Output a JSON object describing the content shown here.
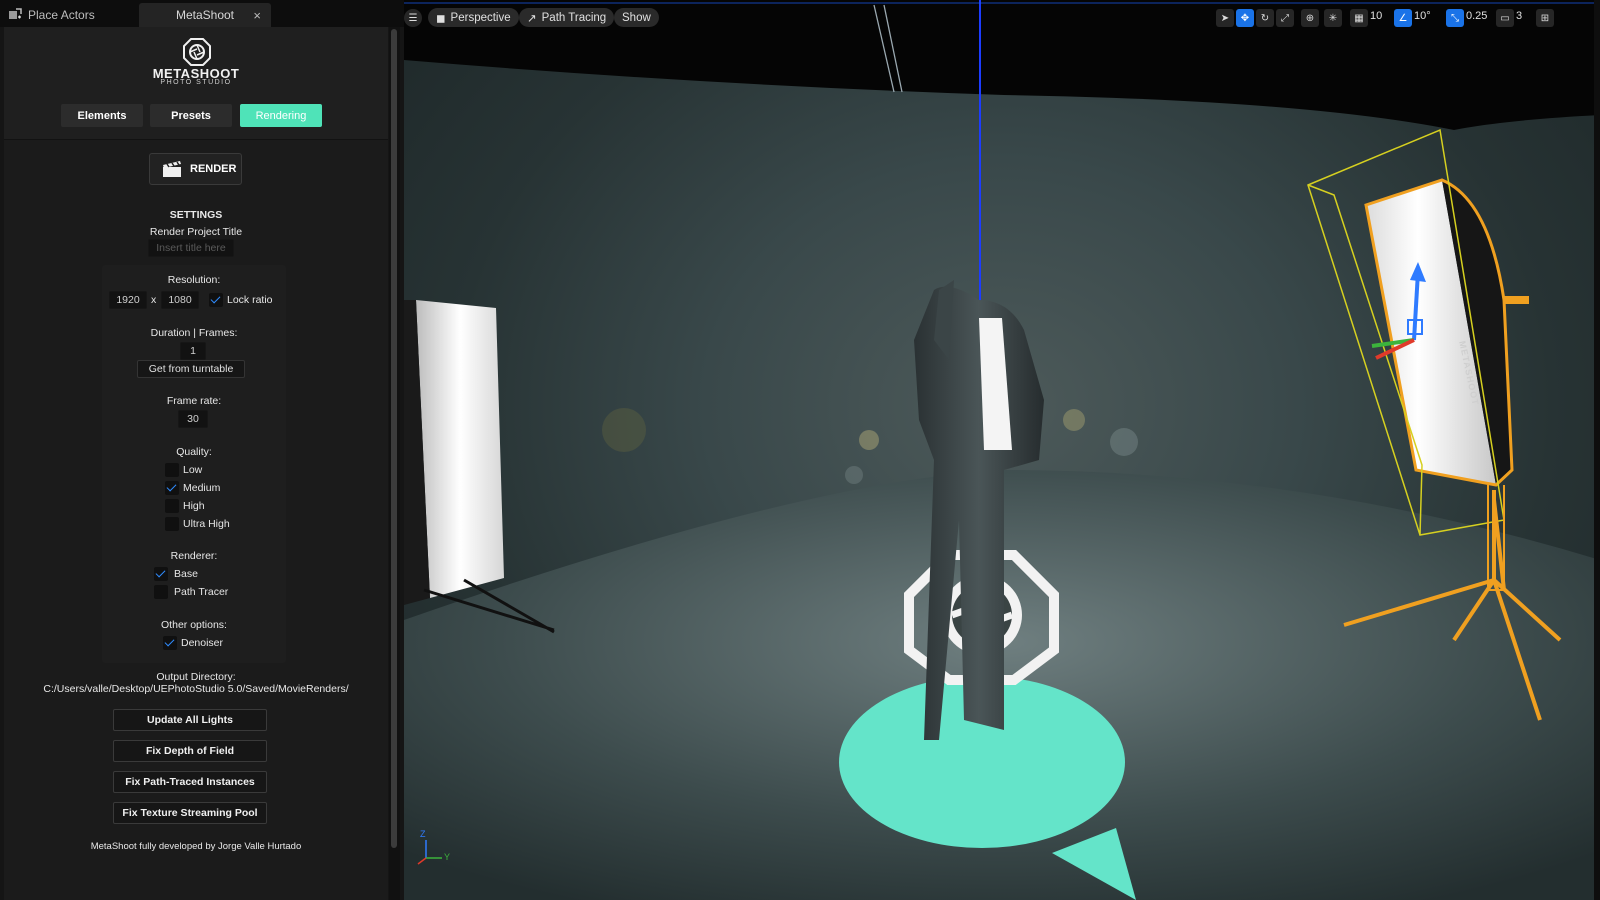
{
  "tabs": {
    "place_actors": "Place Actors",
    "metashoot": "MetaShoot",
    "close": "×"
  },
  "logo": {
    "title": "METASHOOT",
    "subtitle": "PHOTO STUDIO"
  },
  "nav": {
    "elements": "Elements",
    "presets": "Presets",
    "rendering": "Rendering",
    "active": "Rendering"
  },
  "render_button": "RENDER",
  "settings": {
    "heading": "SETTINGS",
    "project_title_label": "Render Project Title",
    "project_title_placeholder": "Insert title here",
    "resolution_label": "Resolution:",
    "width": "1920",
    "x_sep": "x",
    "height": "1080",
    "lock_ratio": "Lock ratio",
    "lock_ratio_checked": true,
    "duration_label": "Duration | Frames:",
    "frames": "1",
    "get_from_turntable": "Get from turntable",
    "frame_rate_label": "Frame rate:",
    "frame_rate": "30",
    "quality_label": "Quality:",
    "quality_options": [
      {
        "label": "Low",
        "checked": false
      },
      {
        "label": "Medium",
        "checked": true
      },
      {
        "label": "High",
        "checked": false
      },
      {
        "label": "Ultra High",
        "checked": false
      }
    ],
    "renderer_label": "Renderer:",
    "renderer_options": [
      {
        "label": "Base",
        "checked": true
      },
      {
        "label": "Path Tracer",
        "checked": false
      }
    ],
    "other_label": "Other options:",
    "denoiser": "Denoiser",
    "denoiser_checked": true
  },
  "output": {
    "label": "Output Directory:",
    "path": "C:/Users/valle/Desktop/UEPhotoStudio 5.0/Saved/MovieRenders/"
  },
  "actions": [
    "Update All Lights",
    "Fix Depth of Field",
    "Fix Path-Traced Instances",
    "Fix Texture Streaming Pool"
  ],
  "footer": "MetaShoot fully developed by Jorge Valle Hurtado",
  "viewport": {
    "perspective": "Perspective",
    "path_tracing": "Path Tracing",
    "show": "Show",
    "grid_snap": "10",
    "rotation_snap": "10°",
    "scale_snap": "0.25",
    "camera_speed": "3",
    "axis_z": "Z",
    "axis_y": "Y",
    "softbox_brand": "METASHOOT",
    "colors": {
      "accent_green": "#4fe3b8",
      "selection_yellow": "#d6d020",
      "selection_orange": "#f0a020",
      "gizmo_blue": "#2f7bff"
    }
  }
}
